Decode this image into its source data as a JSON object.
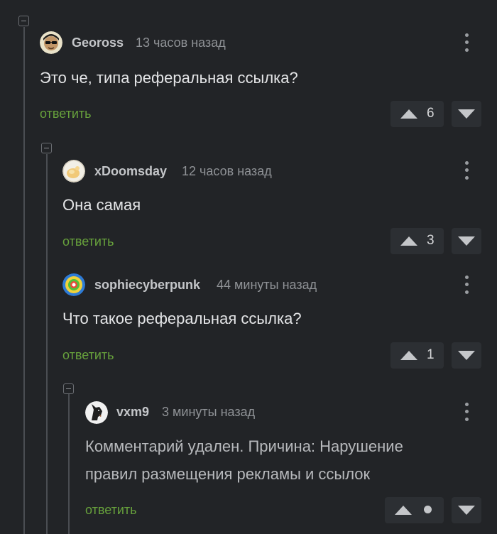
{
  "comments": [
    {
      "username": "Geoross",
      "time": "13 часов назад",
      "text": "Это че, типа реферальная ссылка?",
      "reply_label": "ответить",
      "rating": "6"
    },
    {
      "username": "xDoomsday",
      "time": "12 часов назад",
      "text": "Она самая",
      "reply_label": "ответить",
      "rating": "3"
    },
    {
      "username": "sophiecyberpunk",
      "time": "44 минуты назад",
      "text": "Что такое реферальная ссылка?",
      "reply_label": "ответить",
      "rating": "1"
    },
    {
      "username": "vxm9",
      "time": "3 минуты назад",
      "text_line1": "Комментарий удален. Причина: Нарушение",
      "text_line2": "правил размещения рекламы и ссылок",
      "reply_label": "ответить",
      "rating": ""
    }
  ],
  "colors": {
    "background": "#222427",
    "reply_link": "#67a13c",
    "username": "#c4c6c9",
    "timestamp": "#8f9296"
  },
  "icons": [
    "collapse-icon",
    "kebab-menu-icon",
    "upvote-arrow-icon",
    "downvote-arrow-icon"
  ]
}
